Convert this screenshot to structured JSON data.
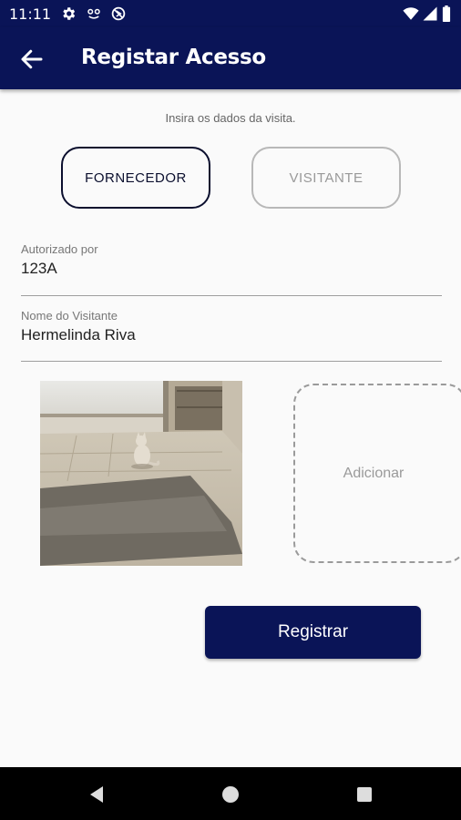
{
  "status_bar": {
    "time": "11:11",
    "left_icons": [
      "gear-icon",
      "face-icon",
      "no-sync-icon"
    ],
    "right_icons": [
      "wifi-icon",
      "signal-icon",
      "battery-icon"
    ]
  },
  "app_bar": {
    "title": "Registar Acesso",
    "back_icon": "arrow-left-icon"
  },
  "form": {
    "hint": "Insira os dados da visita.",
    "type_options": [
      {
        "label": "FORNECEDOR",
        "selected": true
      },
      {
        "label": "VISITANTE",
        "selected": false
      }
    ],
    "authorized_by": {
      "label": "Autorizado por",
      "value": "123A"
    },
    "visitor_name": {
      "label": "Nome do Visitante",
      "value": "Hermelinda Riva"
    },
    "add_photo_label": "Adicionar",
    "submit_label": "Registrar"
  },
  "colors": {
    "primary": "#0a1457",
    "background": "#fafafa",
    "selected_border": "#0b0f2e",
    "inactive_border": "#b8b8b8"
  },
  "nav_bar": {
    "icons": [
      "back-triangle-icon",
      "home-circle-icon",
      "recents-square-icon"
    ]
  }
}
